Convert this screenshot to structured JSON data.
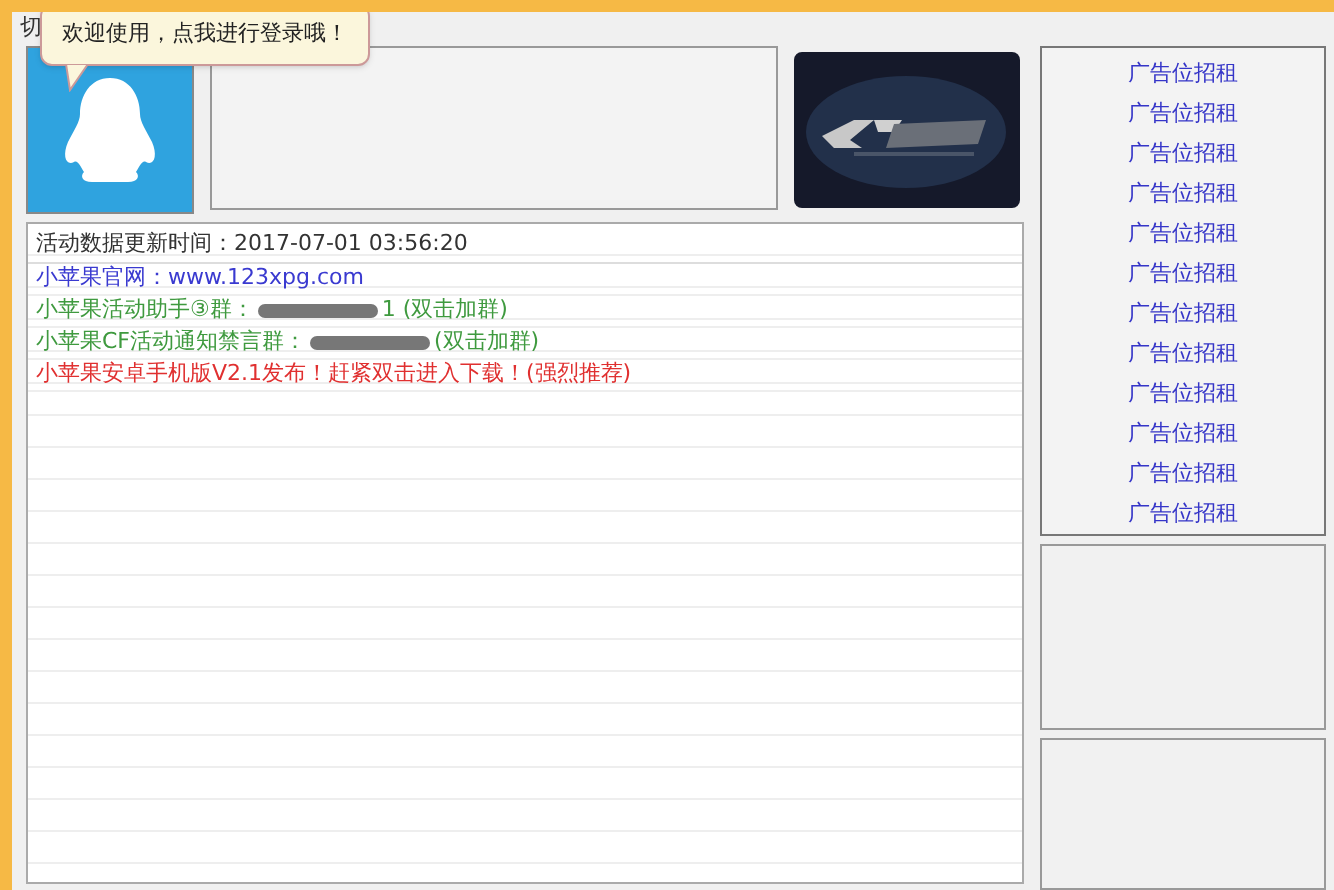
{
  "window": {
    "title": "切"
  },
  "tooltip": {
    "text": "欢迎使用，点我进行登录哦！"
  },
  "log": {
    "header": "活动数据更新时间：2017-07-01 03:56:20",
    "rows": [
      {
        "kind": "link",
        "text": "小苹果官网：www.123xpg.com",
        "color": "#3a3ad0"
      },
      {
        "kind": "group",
        "text": "小苹果活动助手③群：",
        "suffix": "1 (双击加群)",
        "color": "#3f9a3f"
      },
      {
        "kind": "group",
        "text": "小苹果CF活动通知禁言群：",
        "suffix": "(双击加群)",
        "color": "#3f9a3f"
      },
      {
        "kind": "link",
        "text": "小苹果安卓手机版V2.1发布！赶紧双击进入下载！(强烈推荐)",
        "color": "#e03030"
      }
    ]
  },
  "ads": [
    "广告位招租",
    "广告位招租",
    "广告位招租",
    "广告位招租",
    "广告位招租",
    "广告位招租",
    "广告位招租",
    "广告位招租",
    "广告位招租",
    "广告位招租",
    "广告位招租",
    "广告位招租"
  ]
}
